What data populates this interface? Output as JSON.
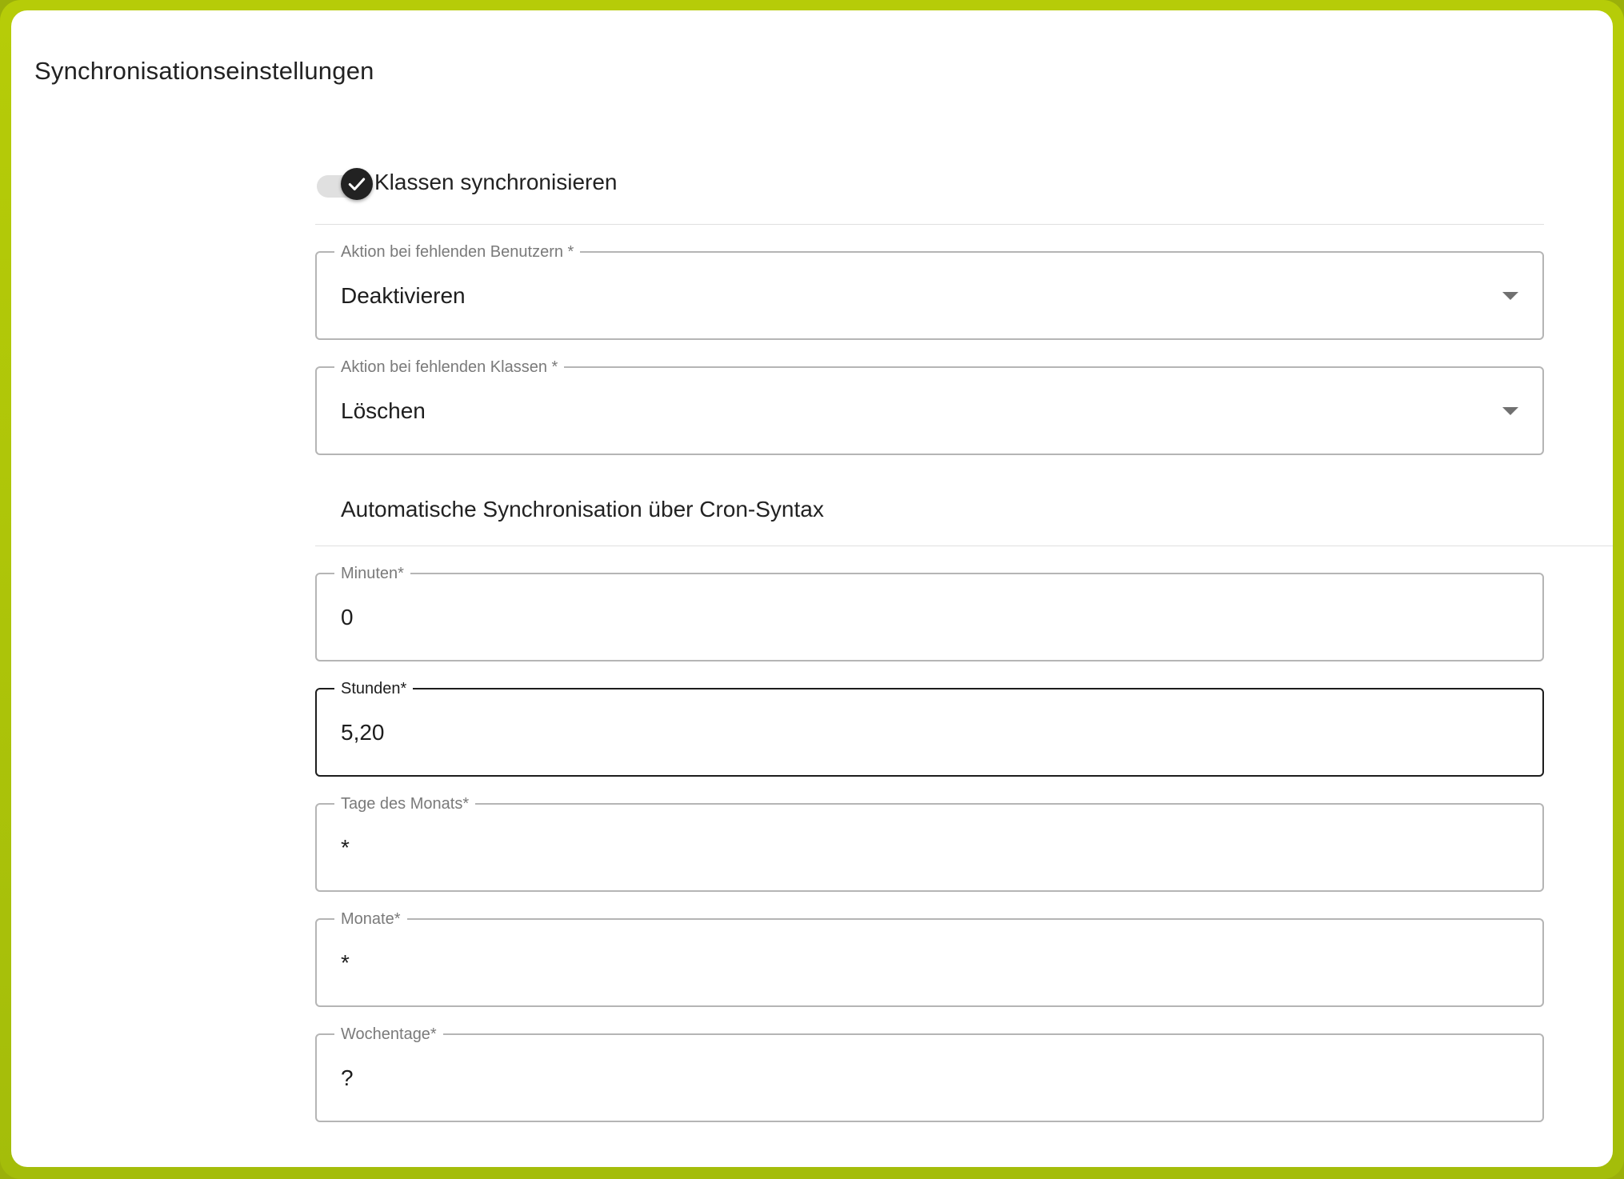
{
  "page": {
    "title": "Synchronisationseinstellungen"
  },
  "toggle": {
    "label": "Klassen synchronisieren",
    "checked": true
  },
  "selects": {
    "missing_users": {
      "label": "Aktion bei fehlenden Benutzern *",
      "value": "Deaktivieren"
    },
    "missing_classes": {
      "label": "Aktion bei fehlenden Klassen *",
      "value": "Löschen"
    }
  },
  "cron": {
    "heading": "Automatische Synchronisation über Cron-Syntax",
    "minutes": {
      "label": "Minuten*",
      "value": "0"
    },
    "hours": {
      "label": "Stunden*",
      "value": "5,20"
    },
    "days_of_month": {
      "label": "Tage des Monats*",
      "value": "*"
    },
    "months": {
      "label": "Monate*",
      "value": "*"
    },
    "weekdays": {
      "label": "Wochentage*",
      "value": "?"
    }
  },
  "colors": {
    "frame": "#a9c20a",
    "toggle_thumb": "#222222",
    "toggle_track": "#e0e0e0",
    "field_border": "#b5b5b5",
    "field_border_focused": "#1d1d1d"
  },
  "icons": {
    "toggle": "check-icon",
    "dropdown": "caret-down-icon"
  }
}
